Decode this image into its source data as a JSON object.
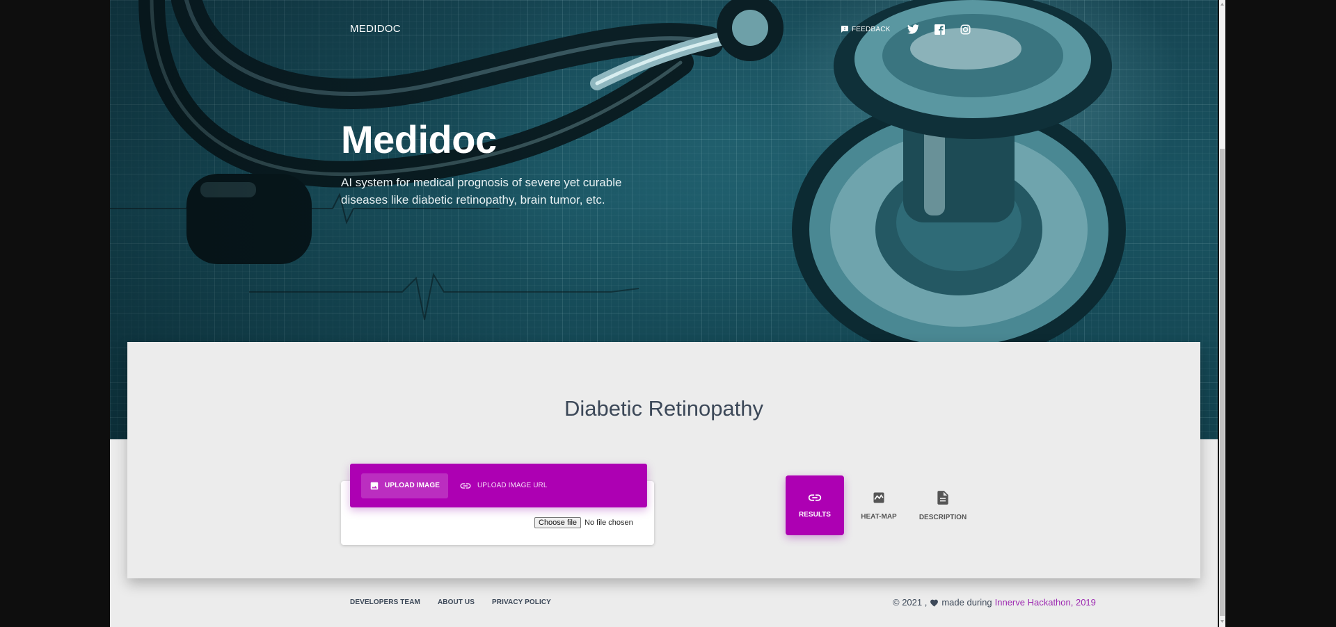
{
  "navbar": {
    "brand": "MEDIDOC",
    "feedback_label": "FEEDBACK",
    "social_icons": [
      "twitter-icon",
      "facebook-icon",
      "instagram-icon"
    ]
  },
  "hero": {
    "title": "Medidoc",
    "subtitle": "AI system for medical prognosis of severe yet curable diseases like diabetic retinopathy, brain tumor, etc."
  },
  "main": {
    "title": "Diabetic Retinopathy",
    "upload_tabs": [
      {
        "label": "UPLOAD IMAGE",
        "icon": "image-icon",
        "active": true
      },
      {
        "label": "UPLOAD IMAGE URL",
        "icon": "link-icon",
        "active": false
      }
    ],
    "file_input": {
      "button_label": "Choose file",
      "status": "No file chosen"
    },
    "result_tabs": [
      {
        "label": "RESULTS",
        "icon": "link-icon",
        "active": true
      },
      {
        "label": "HEAT-MAP",
        "icon": "wave-chart-icon",
        "active": false
      },
      {
        "label": "DESCRIPTION",
        "icon": "document-icon",
        "active": false
      }
    ]
  },
  "footer": {
    "links": [
      "DEVELOPERS TEAM",
      "ABOUT US",
      "PRIVACY POLICY"
    ],
    "copyright_prefix": "© 2021 ,",
    "made_during": "made during",
    "event_link": "Innerve Hackathon, 2019"
  },
  "colors": {
    "accent": "#ad00b3",
    "link": "#9c27b0",
    "text_dark": "#3c4858"
  }
}
